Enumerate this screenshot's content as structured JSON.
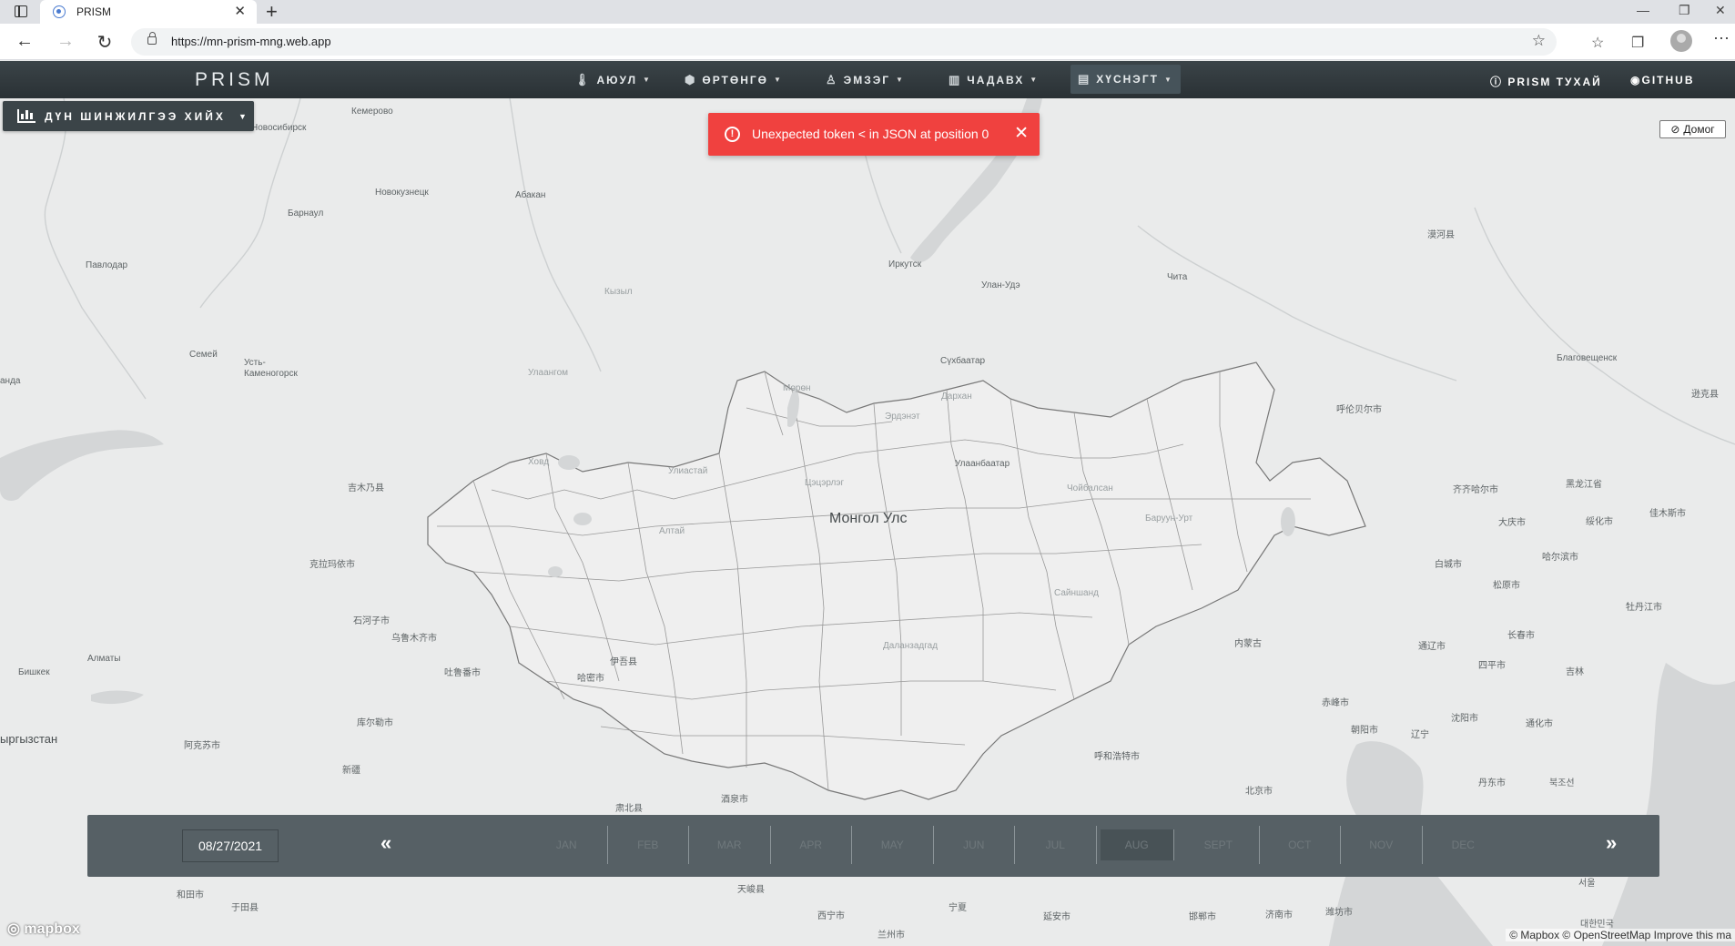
{
  "browser": {
    "tab_title": "PRISM",
    "url": "https://mn-prism-mng.web.app",
    "new_tab": "+",
    "tab_close": "✕",
    "win_minimize": "—",
    "win_restore": "❐",
    "win_close": "✕"
  },
  "navbar": {
    "brand": "PRISM",
    "menus": [
      {
        "label": "АЮУЛ",
        "icon": "thermometer-icon"
      },
      {
        "label": "ӨРТӨНГӨ",
        "icon": "layers-icon"
      },
      {
        "label": "ЭМЗЭГ",
        "icon": "person-icon"
      },
      {
        "label": "ЧАДАВХ",
        "icon": "building-icon"
      },
      {
        "label": "ХҮСНЭГТ",
        "icon": "table-icon"
      }
    ],
    "about": "PRISM ТУХАЙ",
    "github": "GITHUB"
  },
  "analysis_button": "ДҮН ШИНЖИЛГЭЭ ХИЙХ",
  "toast": {
    "message": "Unexpected token < in JSON at position 0",
    "color": "#f0413f"
  },
  "legend_button": "Домог",
  "map": {
    "country_label": "Монгол Улс",
    "cities": [
      "Кемерово",
      "Новосибирск",
      "Новокузнецк",
      "Абакан",
      "Барнаул",
      "Павлодар",
      "Иркутск",
      "Улан-Удэ",
      "Чита",
      "Кызыл",
      "Семей",
      "Усть-Каменогорск",
      "Сүхбаатар",
      "Улаангом",
      "Мөрөн",
      "Дархан",
      "Эрдэнэт",
      "Ховд",
      "Улиастай",
      "Улаанбаатар",
      "Цэцэрлэг",
      "Алтай",
      "Чойбалсан",
      "Баруун-Урт",
      "Сайншанд",
      "Даланзадгад",
      "漠河县",
      "Благовещенск",
      "呼伦贝尔市",
      "逊克县",
      "齐齐哈尔市",
      "黑龙江省",
      "大庆市",
      "绥化市",
      "佳木斯市",
      "哈尔滨市",
      "白城市",
      "松原市",
      "牡丹江市",
      "长春市",
      "四平市",
      "吉林",
      "通辽市",
      "内蒙古",
      "赤峰市",
      "朝阳市",
      "辽宁",
      "沈阳市",
      "通化市",
      "呼和浩特市",
      "北京市",
      "丹东市",
      "북조선",
      "서울",
      "대한민국",
      "吉木乃县",
      "克拉玛依市",
      "石河子市",
      "乌鲁木齐市",
      "吐鲁番市",
      "哈密市",
      "伊吾县",
      "库尔勒市",
      "阿克苏市",
      "新疆",
      "Алматы",
      "Бишкек",
      "ыргызстан",
      "Семей",
      "анда",
      "和田市",
      "于田县",
      "肃北县",
      "酒泉市",
      "天峻县",
      "西宁市",
      "宁夏",
      "兰州市",
      "延安市",
      "邯郸市",
      "济南市",
      "潍坊市"
    ]
  },
  "timeline": {
    "date": "08/27/2021",
    "prev": "«",
    "next": "»",
    "months": [
      "JAN",
      "FEB",
      "MAR",
      "APR",
      "MAY",
      "JUN",
      "JUL",
      "AUG",
      "SEPT",
      "OCT",
      "NOV",
      "DEC"
    ],
    "selected_month": "AUG"
  },
  "attribution": {
    "logo": "mapbox",
    "text": "© Mapbox © OpenStreetMap Improve this ma"
  }
}
